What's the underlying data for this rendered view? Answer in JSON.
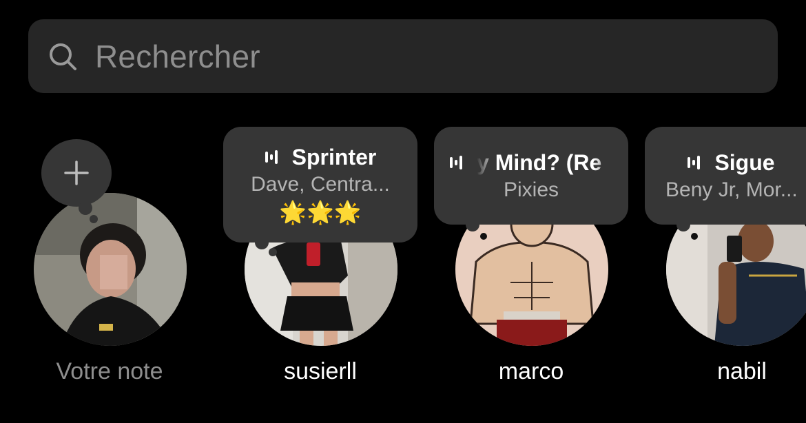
{
  "search": {
    "placeholder": "Rechercher",
    "icon": "search-icon"
  },
  "notes": [
    {
      "name": "Votre note",
      "self": true,
      "add_icon": "plus-icon"
    },
    {
      "name": "susierll",
      "song_title": "Sprinter",
      "artist": "Dave, Centra...",
      "emoji": "🌟🌟🌟",
      "icon": "audio-wave-icon"
    },
    {
      "name": "marco",
      "song_title": "y Mind? (Re",
      "artist": "Pixies",
      "icon": "audio-wave-icon"
    },
    {
      "name": "nabil",
      "song_title": "Sigue",
      "artist": "Beny Jr, Mor...",
      "icon": "audio-wave-icon"
    }
  ],
  "colors": {
    "background": "#000000",
    "search_bg": "#262626",
    "bubble_bg": "#363636",
    "muted_text": "#8e8e8e"
  }
}
